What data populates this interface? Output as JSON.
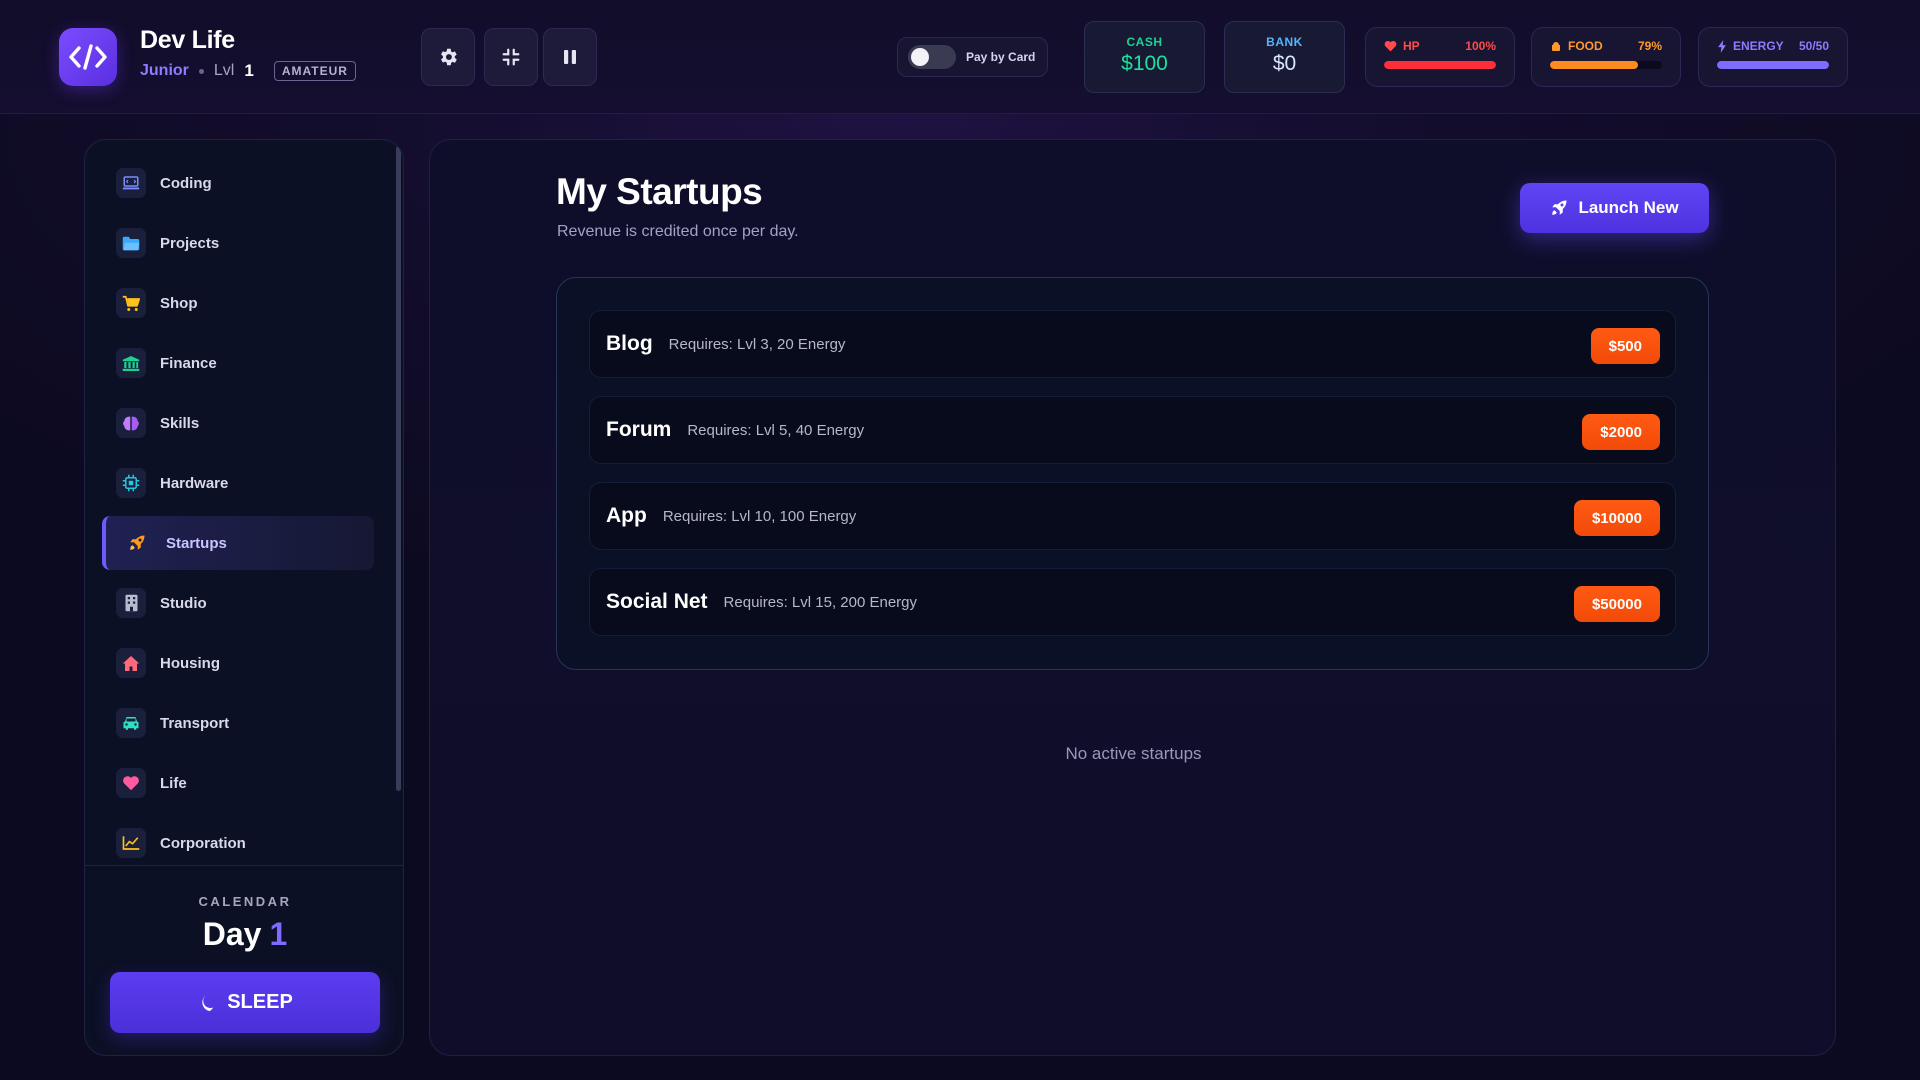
{
  "app": {
    "title": "Dev Life",
    "rank": "Junior",
    "lvl_label": "Lvl",
    "lvl_value": "1",
    "tier": "AMATEUR"
  },
  "header": {
    "controls": [
      {
        "name": "settings-button",
        "icon": "gear-icon"
      },
      {
        "name": "fullscreen-exit-button",
        "icon": "compress-icon"
      },
      {
        "name": "pause-button",
        "icon": "pause-icon"
      }
    ],
    "pay_by_card": {
      "label": "Pay by Card",
      "enabled": false
    },
    "cash": {
      "label": "CASH",
      "value": "$100",
      "color": "#1ee09c"
    },
    "bank": {
      "label": "BANK",
      "value": "$0",
      "color": "#56b4ff"
    },
    "stats": {
      "hp": {
        "label": "HP",
        "value": "100%",
        "fraction": 1.0,
        "color": "#ff3b3b",
        "icon": "heart-icon"
      },
      "food": {
        "label": "FOOD",
        "value": "79%",
        "fraction": 0.79,
        "color": "#ff8a1f",
        "icon": "food-icon"
      },
      "energy": {
        "label": "ENERGY",
        "value": "50/50",
        "fraction": 1.0,
        "color": "#7c6cff",
        "icon": "lightning-icon"
      }
    }
  },
  "sidebar": {
    "items": [
      {
        "label": "Coding",
        "icon": "laptop-icon",
        "color": "#7a8cff"
      },
      {
        "label": "Projects",
        "icon": "folder-icon",
        "color": "#3aa8ff"
      },
      {
        "label": "Shop",
        "icon": "cart-icon",
        "color": "#ffc21a"
      },
      {
        "label": "Finance",
        "icon": "bank-icon",
        "color": "#19d393"
      },
      {
        "label": "Skills",
        "icon": "brain-icon",
        "color": "#c07cff"
      },
      {
        "label": "Hardware",
        "icon": "chip-icon",
        "color": "#22c8e0"
      },
      {
        "label": "Startups",
        "icon": "rocket-icon",
        "color": "#ff9a1a",
        "active": true
      },
      {
        "label": "Studio",
        "icon": "building-icon",
        "color": "#b8bcd0"
      },
      {
        "label": "Housing",
        "icon": "house-icon",
        "color": "#ff6a7a"
      },
      {
        "label": "Transport",
        "icon": "car-icon",
        "color": "#2ee0c0"
      },
      {
        "label": "Life",
        "icon": "heart-icon",
        "color": "#ff5aa0"
      },
      {
        "label": "Corporation",
        "icon": "chart-icon",
        "color": "#ffc21a"
      }
    ],
    "calendar": {
      "label": "CALENDAR",
      "day_label": "Day",
      "day_value": "1"
    },
    "sleep": {
      "label": "SLEEP",
      "icon": "moon-icon"
    }
  },
  "main": {
    "title": "My Startups",
    "subtitle": "Revenue is credited once per day.",
    "launch": {
      "label": "Launch New",
      "icon": "rocket-icon"
    },
    "startups": [
      {
        "name": "Blog",
        "requirements": "Requires: Lvl 3, 20 Energy",
        "price": "$500"
      },
      {
        "name": "Forum",
        "requirements": "Requires: Lvl 5, 40 Energy",
        "price": "$2000"
      },
      {
        "name": "App",
        "requirements": "Requires: Lvl 10, 100 Energy",
        "price": "$10000"
      },
      {
        "name": "Social Net",
        "requirements": "Requires: Lvl 15, 200 Energy",
        "price": "$50000"
      }
    ],
    "empty_message": "No active startups"
  }
}
